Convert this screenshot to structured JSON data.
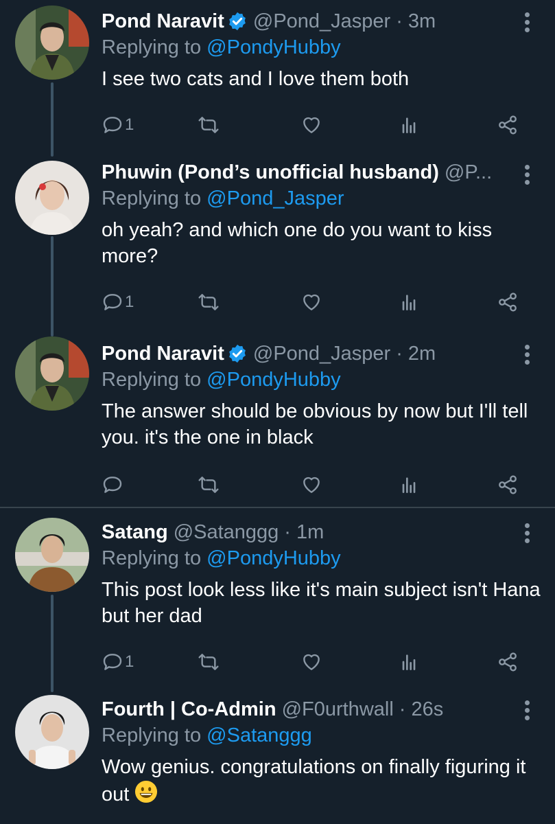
{
  "colors": {
    "background": "#15202b",
    "text": "#ffffff",
    "muted": "#8b98a5",
    "accent": "#1d9bf0",
    "verified": "#1d9bf0"
  },
  "icons": {
    "reply": "reply-icon",
    "retweet": "retweet-icon",
    "like": "heart-icon",
    "stats": "stats-icon",
    "share": "share-icon",
    "more": "more-vertical-icon",
    "verified": "verified-badge-icon"
  },
  "tweets": [
    {
      "name": "Pond Naravit",
      "verified": true,
      "handle": "@Pond_Jasper",
      "separator": "·",
      "time": "3m",
      "replying_prefix": "Replying to ",
      "replying_to": "@PondyHubby",
      "text": "I see two cats and I love them both",
      "reply_count": "1"
    },
    {
      "name": "Phuwin (Pond’s unofficial husband)",
      "verified": false,
      "handle": "@P...",
      "replying_prefix": "Replying to ",
      "replying_to": "@Pond_Jasper",
      "text": "oh yeah? and which one do you want to kiss more?",
      "reply_count": "1"
    },
    {
      "name": "Pond Naravit",
      "verified": true,
      "handle": "@Pond_Jasper",
      "separator": "·",
      "time": "2m",
      "replying_prefix": "Replying to ",
      "replying_to": "@PondyHubby",
      "text": "The answer should be obvious by now but I'll tell you. it's the one in black",
      "reply_count": ""
    },
    {
      "name": "Satang",
      "verified": false,
      "handle": "@Satanggg",
      "separator": "·",
      "time": "1m",
      "replying_prefix": "Replying to ",
      "replying_to": "@PondyHubby",
      "text": "This post look less like it's main subject isn't Hana but her dad",
      "reply_count": "1"
    },
    {
      "name": "Fourth | Co-Admin",
      "verified": false,
      "handle": "@F0urthwall",
      "separator": "·",
      "time": "26s",
      "replying_prefix": "Replying to ",
      "replying_to": "@Satanggg",
      "text": "Wow genius. congratulations on finally figuring it out",
      "emoji": "grinning-face-emoji"
    }
  ]
}
